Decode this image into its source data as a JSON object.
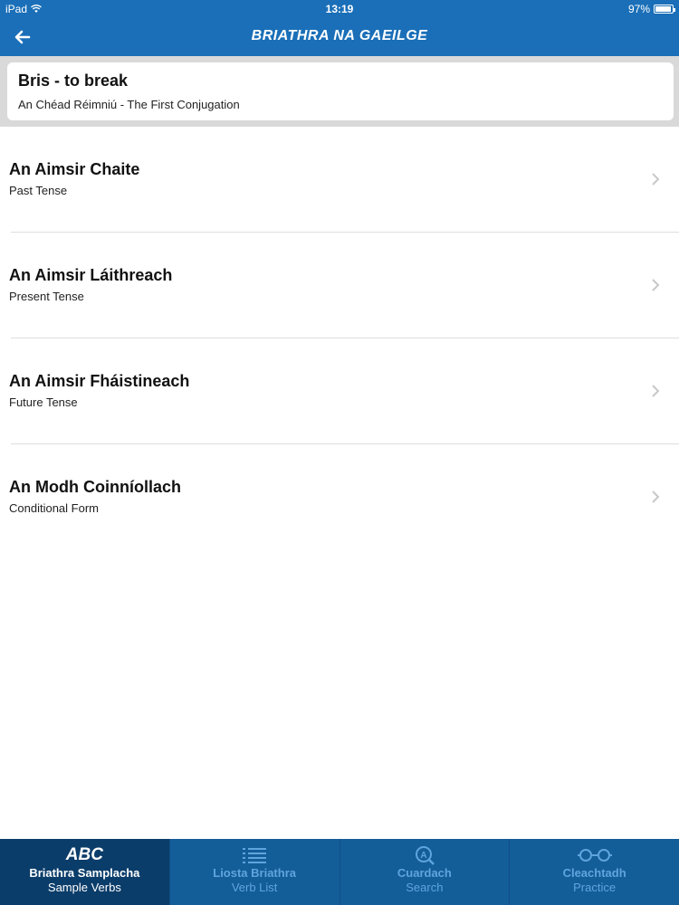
{
  "status": {
    "device": "iPad",
    "time": "13:19",
    "battery": "97%"
  },
  "nav": {
    "title": "BRIATHRA NA GAEILGE"
  },
  "header": {
    "title": "Bris - to break",
    "subtitle": "An Chéad Réimniú - The First Conjugation"
  },
  "rows": [
    {
      "name": "An Aimsir Chaite",
      "sub": "Past Tense"
    },
    {
      "name": "An Aimsir Láithreach",
      "sub": "Present Tense"
    },
    {
      "name": "An Aimsir Fháistineach",
      "sub": "Future Tense"
    },
    {
      "name": "An Modh Coinníollach",
      "sub": "Conditional Form"
    }
  ],
  "tabs": [
    {
      "icon_text": "ABC",
      "label": "Briathra Samplacha",
      "sub": "Sample Verbs",
      "icon": "abc-icon"
    },
    {
      "label": "Liosta Briathra",
      "sub": "Verb List",
      "icon": "list-icon"
    },
    {
      "label": "Cuardach",
      "sub": "Search",
      "icon": "search-icon"
    },
    {
      "label": "Cleachtadh",
      "sub": "Practice",
      "icon": "glasses-icon"
    }
  ],
  "colors": {
    "primary": "#1a6fb8",
    "tabbar": "#135d99",
    "tab_active": "#0b3d6a",
    "tab_inactive_text": "#5fa5dd"
  }
}
